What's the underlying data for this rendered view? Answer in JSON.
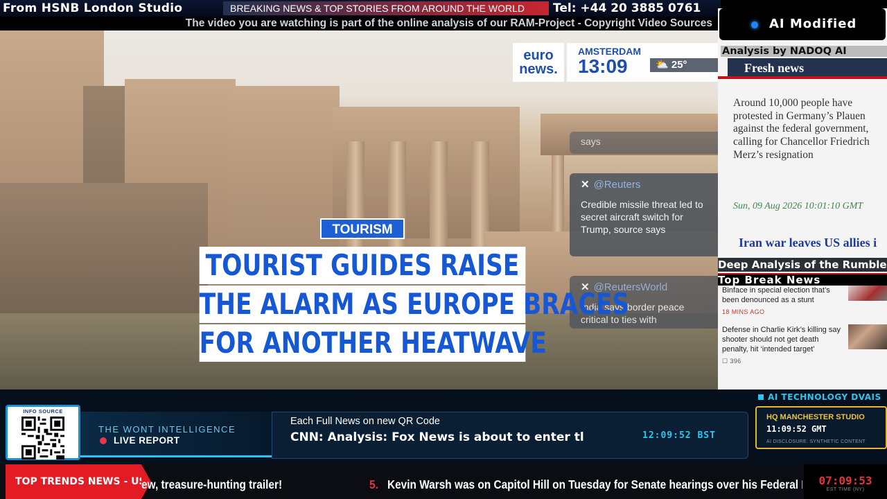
{
  "top_bar": {
    "studio": "From HSNB London Studio",
    "breaking": "BREAKING NEWS & TOP STORIES FROM AROUND THE WORLD",
    "tel": "Tel: +44 20 3885 0761",
    "subtitle": "The video you are watching is part of the online analysis of our RAM-Project - Copyright Video Sources"
  },
  "video": {
    "logo_line1": "euro",
    "logo_line2": "news.",
    "city": "AMSTERDAM",
    "time": "13:09",
    "temperature": "25°",
    "faded_top": "says",
    "tweet1_handle": "@Reuters",
    "tweet1_text": "Credible missile threat led to secret aircraft switch for Trump, source says",
    "tweet2_handle": "@ReutersWorld",
    "tweet2_text": "India says border peace critical to ties with",
    "tag": "TOURISM",
    "headline_1": "TOURIST GUIDES RAISE",
    "headline_2": "THE ALARM AS EUROPE BRACES",
    "headline_3": "FOR ANOTHER HEATWAVE"
  },
  "right_panel": {
    "ai_modified": "AI Modified",
    "analysis_by": "Analysis by NADOQ AI",
    "fresh_news": "Fresh news",
    "story": "Around 10,000 people have protested in Germany’s Plauen against the federal government, calling for Chancellor Friedrich Merz’s resignation",
    "story_date": "Sun, 09 Aug 2026 10:01:10 GMT",
    "next_story": "Iran war leaves US allies in Asia",
    "deep_analysis": "Deep Analysis of the Rumble",
    "top_break": "Top Break News",
    "news_items": [
      {
        "title": "Binface in special election that’s been denounced as a stunt",
        "meta": "18 MINS AGO"
      },
      {
        "title": "Defense in Charlie Kirk’s killing say shooter should not get death penalty, hit ‘intended target’",
        "meta": "396"
      }
    ]
  },
  "bottom": {
    "info_source": "INFO SOURCE",
    "intel_title": "THE WONT INTELLIGENCE",
    "live_report": "LIVE REPORT",
    "news_head": "Each Full News on new QR Code",
    "news_body": "CNN: Analysis: Fox News is about to enter tl",
    "news_clock": "12:09:52 BST",
    "ai_tech": "AI TECHNOLOGY DVAIS",
    "hq_name": "HQ MANCHESTER STUDIO",
    "hq_time": "11:09:52 GMT",
    "hq_disclosure": "AI DISCLOSURE: SYNTHETIC CONTENT",
    "trends_label": "TOP TRENDS NEWS - US",
    "ticker_prev": "ew, treasure-hunting trailer!",
    "ticker_num": "5.",
    "ticker_text": "Kevin Warsh was on Capitol Hill on Tuesday for Senate hearings over his Federal Reserve chair",
    "clock": "07:09:53",
    "clock_zone": "EST TIME (NY)"
  }
}
